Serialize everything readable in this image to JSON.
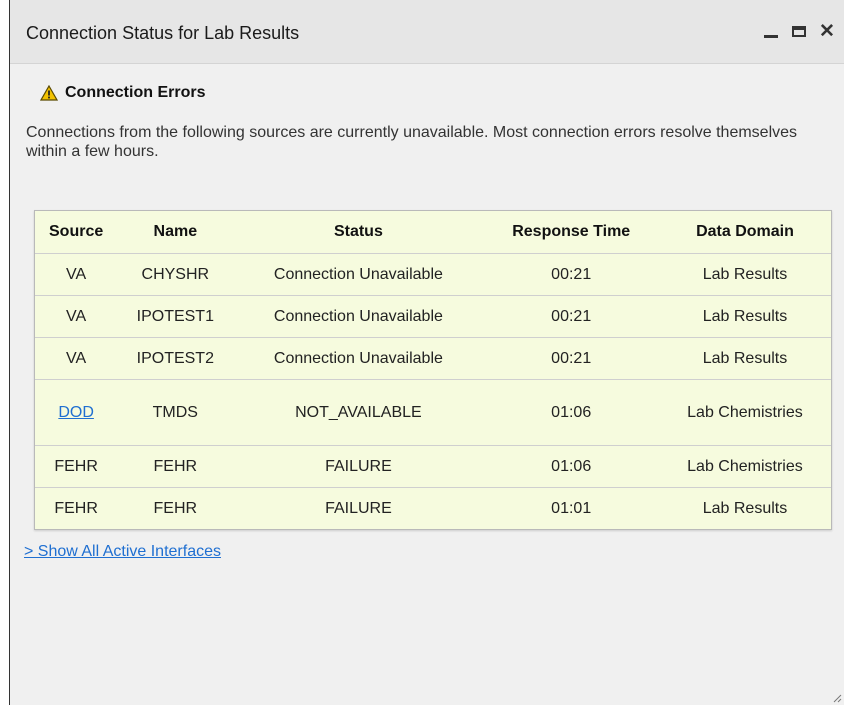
{
  "window": {
    "title": "Connection Status for Lab Results",
    "controls": {
      "minimize_icon": "minimize-icon",
      "maximize_icon": "maximize-icon",
      "close_icon": "close-icon"
    }
  },
  "errors_section": {
    "heading": "Connection Errors",
    "icon": "warning-icon",
    "description": "Connections from the following sources are currently unavailable. Most connection errors resolve themselves within a few hours."
  },
  "table": {
    "columns": [
      "Source",
      "Name",
      "Status",
      "Response Time",
      "Data Domain"
    ],
    "rows": [
      [
        "VA",
        "CHYSHR",
        "Connection Unavailable",
        "00:21",
        "Lab Results"
      ],
      [
        "VA",
        "IPOTEST1",
        "Connection Unavailable",
        "00:21",
        "Lab Results"
      ],
      [
        "VA",
        "IPOTEST2",
        "Connection Unavailable",
        "00:21",
        "Lab Results"
      ],
      [
        "DOD",
        "TMDS",
        "NOT_AVAILABLE",
        "01:06",
        "Lab Chemistries"
      ],
      [
        "FEHR",
        "FEHR",
        "FAILURE",
        "01:06",
        "Lab Chemistries"
      ],
      [
        "FEHR",
        "FEHR",
        "FAILURE",
        "01:01",
        "Lab Results"
      ]
    ]
  },
  "footer": {
    "show_all_link": "> Show All Active Interfaces"
  },
  "colors": {
    "table_bg": "#f6fbde",
    "link": "#1f6fd1",
    "warning": "#f2c200"
  }
}
